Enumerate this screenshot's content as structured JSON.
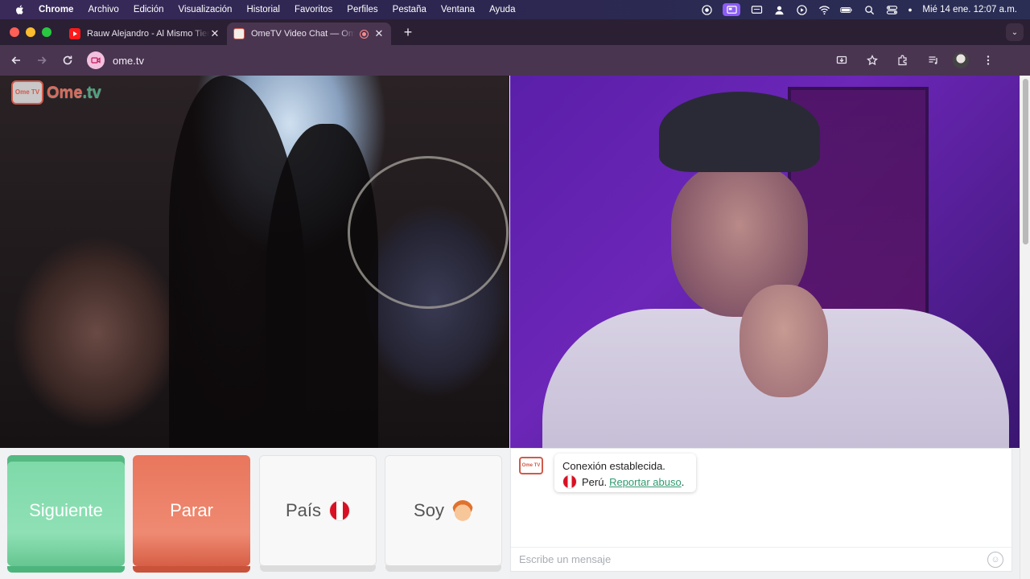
{
  "menubar": {
    "app": "Chrome",
    "items": [
      "Archivo",
      "Edición",
      "Visualización",
      "Historial",
      "Favoritos",
      "Perfiles",
      "Pestaña",
      "Ventana",
      "Ayuda"
    ],
    "clock": "Mié 14 ene.  12:07 a.m."
  },
  "tabs": [
    {
      "title": "Rauw Alejandro - Al Mismo Tiempo",
      "favicon": "youtube-icon",
      "active": false
    },
    {
      "title": "OmeTV Video Chat — Omegle",
      "favicon": "ometv-icon",
      "active": true,
      "recording": true
    }
  ],
  "toolbar": {
    "url": "ome.tv"
  },
  "brand": {
    "logo_badge": "Ome TV",
    "logo_name": "Ome",
    "logo_tld": ".tv"
  },
  "controls": {
    "next_label": "Siguiente",
    "stop_label": "Parar",
    "country_label": "País",
    "country_flag": "peru-flag",
    "gender_label": "Soy",
    "gender_icon": "boy-emoji"
  },
  "chat": {
    "bot_badge": "Ome TV",
    "message_line1": "Conexión establecida.",
    "message_country": "Perú.",
    "report_link": "Reportar abuso",
    "report_suffix": ".",
    "input_placeholder": "Escribe un mensaje"
  },
  "colors": {
    "next": "#7dd9a8",
    "stop": "#e8765c",
    "link": "#2f9a6f",
    "brand": "#d86a5a"
  }
}
